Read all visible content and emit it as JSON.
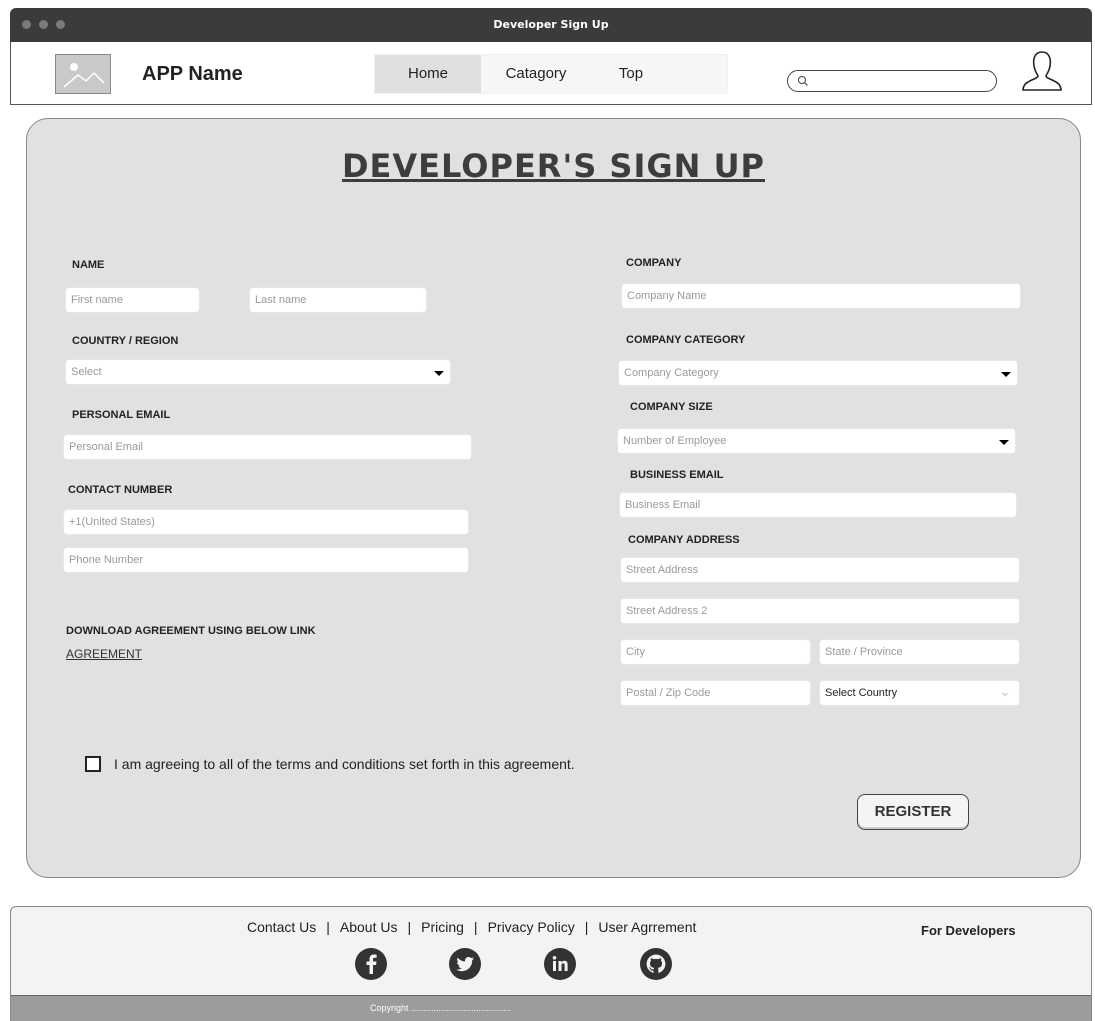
{
  "window": {
    "title": "Developer Sign Up"
  },
  "header": {
    "app_name": "APP Name",
    "nav": [
      {
        "label": "Home",
        "active": true
      },
      {
        "label": "Catagory"
      },
      {
        "label": "Top"
      }
    ],
    "search": {
      "placeholder": "",
      "icon": "search-icon"
    },
    "user_icon": "user-icon",
    "logo_icon": "image-placeholder-icon"
  },
  "form": {
    "title": "DEVELOPER'S SIGN UP",
    "left": {
      "name_label": "NAME",
      "first_name": {
        "placeholder": "First name"
      },
      "last_name": {
        "placeholder": "Last name"
      },
      "country_label": "COUNTRY / REGION",
      "country_select": {
        "value": "Select"
      },
      "personal_email_label": "PERSONAL EMAIL",
      "personal_email": {
        "placeholder": "Personal Email"
      },
      "contact_label": "CONTACT NUMBER",
      "country_code": {
        "placeholder": "+1(United States)"
      },
      "phone": {
        "placeholder": "Phone Number"
      },
      "download_label": "DOWNLOAD AGREEMENT USING BELOW LINK",
      "agreement_link": "AGREEMENT"
    },
    "right": {
      "company_label": "COMPANY",
      "company_name": {
        "placeholder": "Company Name"
      },
      "company_category_label": "COMPANY CATEGORY",
      "company_category": {
        "value": "Company Category"
      },
      "company_size_label": "COMPANY SIZE",
      "company_size": {
        "value": "Number of Employee"
      },
      "business_email_label": "BUSINESS EMAIL",
      "business_email": {
        "placeholder": "Business Email"
      },
      "address_label": "COMPANY ADDRESS",
      "street1": {
        "placeholder": "Street Address"
      },
      "street2": {
        "placeholder": "Street Address 2"
      },
      "city": {
        "placeholder": "City"
      },
      "state": {
        "placeholder": "State / Province"
      },
      "postal": {
        "placeholder": "Postal / Zip Code"
      },
      "country_select": {
        "value": "Select Country"
      }
    },
    "terms": {
      "checked": false,
      "text": "I am agreeing to all of the terms and conditions set forth in this agreement."
    },
    "register_label": "REGISTER"
  },
  "footer": {
    "links": [
      "Contact Us",
      "About Us",
      "Pricing",
      "Privacy Policy",
      "User Agrrement"
    ],
    "separator": "|",
    "for_developers": "For Developers",
    "social": [
      "facebook-icon",
      "twitter-icon",
      "linkedin-icon",
      "github-icon"
    ],
    "copyright": "Copyright ........................................"
  },
  "colors": {
    "titlebar": "#3b3b3b",
    "panel": "#e1e1e1",
    "copyright_bar": "#9c9c9c",
    "social_icon": "#333333"
  }
}
